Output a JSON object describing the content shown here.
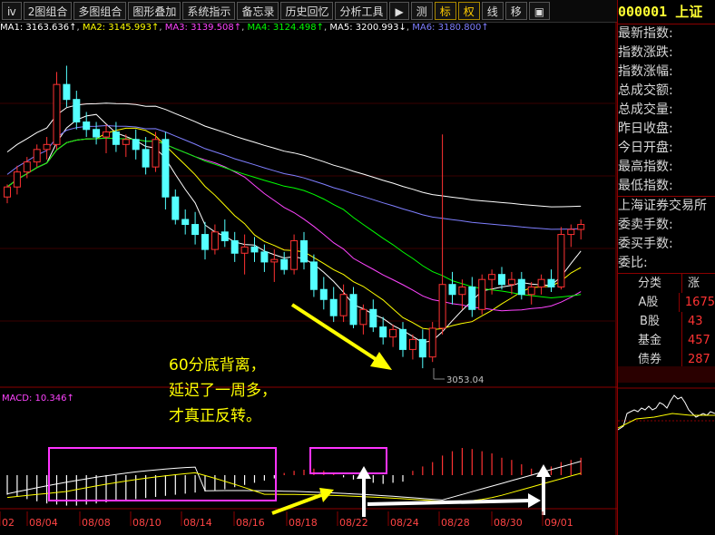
{
  "toolbar": {
    "buttons": [
      "2图组合",
      "多图组合",
      "图形叠加",
      "系统指示",
      "备忘录",
      "历史回忆",
      "分析工具"
    ],
    "right_buttons": [
      "测",
      "标",
      "权",
      "线",
      "移"
    ],
    "play_icon": "play-icon",
    "close_icon": "close-icon"
  },
  "ma_legend": {
    "ma1": "MA1: 3163.636↑",
    "ma2": "MA2: 3145.993↑",
    "ma3": "MA3: 3139.508↑",
    "ma4": "MA4: 3124.498↑",
    "ma5": "MA5: 3200.993↓",
    "ma6": "MA6: 3180.800↑",
    "colors": {
      "ma1": "#ffffff",
      "ma2": "#ffff00",
      "ma3": "#ff44ff",
      "ma4": "#00ff00",
      "ma5": "#7f7fff",
      "ma6": "#ffffff"
    }
  },
  "macd_label": "MACD: 10.346↑",
  "low_label": "3053.04",
  "annotation": [
    "60分底背离，",
    "延迟了一周多，",
    "才真正反转。"
  ],
  "x_ticks": [
    "02",
    "08/04",
    "08/08",
    "08/10",
    "08/14",
    "08/16",
    "08/18",
    "08/22",
    "08/24",
    "08/28",
    "08/30",
    "09/01"
  ],
  "right_panel": {
    "code": "000001",
    "name": "上证",
    "fields": [
      "最新指数:",
      "指数涨跌:",
      "指数涨幅:",
      "总成交额:",
      "总成交量:",
      "昨日收盘:",
      "今日开盘:",
      "最高指数:",
      "最低指数:"
    ],
    "exchange": "上海证券交易所",
    "order_fields": [
      "委卖手数:",
      "委买手数:",
      "委比:"
    ],
    "table_head": [
      "分类",
      "涨"
    ],
    "table_rows": [
      [
        "A股",
        "1675"
      ],
      [
        "B股",
        "43"
      ],
      [
        "基金",
        "457"
      ],
      [
        "债券",
        "287"
      ]
    ]
  },
  "colors": {
    "up": "#ff3232",
    "down": "#54ffff",
    "annotation_text": "#ffff00",
    "box": "#ff33ff",
    "arrow_yellow": "#ffff00",
    "arrow_white": "#ffffff",
    "divider": "#8b0000"
  },
  "chart_data": {
    "type": "candlestick",
    "price_range": [
      3040,
      3320
    ],
    "low_marker": 3053.04,
    "candles": [
      [
        3190,
        3200,
        3185,
        3198
      ],
      [
        3198,
        3215,
        3192,
        3210
      ],
      [
        3210,
        3222,
        3205,
        3218
      ],
      [
        3218,
        3232,
        3214,
        3228
      ],
      [
        3228,
        3238,
        3220,
        3232
      ],
      [
        3232,
        3290,
        3228,
        3280
      ],
      [
        3280,
        3295,
        3262,
        3268
      ],
      [
        3268,
        3275,
        3244,
        3250
      ],
      [
        3250,
        3258,
        3238,
        3244
      ],
      [
        3244,
        3250,
        3232,
        3238
      ],
      [
        3238,
        3248,
        3225,
        3242
      ],
      [
        3242,
        3250,
        3226,
        3232
      ],
      [
        3232,
        3240,
        3222,
        3236
      ],
      [
        3236,
        3244,
        3220,
        3228
      ],
      [
        3228,
        3238,
        3208,
        3214
      ],
      [
        3214,
        3242,
        3210,
        3236
      ],
      [
        3236,
        3242,
        3180,
        3190
      ],
      [
        3190,
        3196,
        3168,
        3172
      ],
      [
        3172,
        3180,
        3160,
        3168
      ],
      [
        3168,
        3178,
        3152,
        3160
      ],
      [
        3160,
        3170,
        3140,
        3148
      ],
      [
        3148,
        3168,
        3144,
        3162
      ],
      [
        3162,
        3172,
        3150,
        3155
      ],
      [
        3155,
        3162,
        3138,
        3145
      ],
      [
        3145,
        3160,
        3128,
        3150
      ],
      [
        3150,
        3158,
        3138,
        3146
      ],
      [
        3146,
        3152,
        3130,
        3138
      ],
      [
        3138,
        3148,
        3122,
        3140
      ],
      [
        3140,
        3146,
        3128,
        3132
      ],
      [
        3132,
        3160,
        3128,
        3155
      ],
      [
        3155,
        3162,
        3132,
        3138
      ],
      [
        3138,
        3144,
        3110,
        3116
      ],
      [
        3116,
        3126,
        3100,
        3108
      ],
      [
        3108,
        3118,
        3090,
        3095
      ],
      [
        3095,
        3120,
        3090,
        3112
      ],
      [
        3112,
        3118,
        3085,
        3088
      ],
      [
        3088,
        3104,
        3080,
        3100
      ],
      [
        3100,
        3108,
        3082,
        3086
      ],
      [
        3086,
        3094,
        3072,
        3078
      ],
      [
        3078,
        3088,
        3070,
        3084
      ],
      [
        3084,
        3090,
        3062,
        3068
      ],
      [
        3068,
        3080,
        3060,
        3076
      ],
      [
        3076,
        3084,
        3053,
        3062
      ],
      [
        3062,
        3090,
        3058,
        3085
      ],
      [
        3085,
        3240,
        3080,
        3120
      ],
      [
        3120,
        3130,
        3104,
        3112
      ],
      [
        3112,
        3124,
        3100,
        3118
      ],
      [
        3118,
        3126,
        3094,
        3100
      ],
      [
        3100,
        3128,
        3096,
        3124
      ],
      [
        3124,
        3132,
        3112,
        3128
      ],
      [
        3128,
        3134,
        3116,
        3120
      ],
      [
        3120,
        3130,
        3112,
        3124
      ],
      [
        3124,
        3130,
        3108,
        3112
      ],
      [
        3112,
        3122,
        3104,
        3118
      ],
      [
        3118,
        3128,
        3112,
        3124
      ],
      [
        3124,
        3132,
        3114,
        3118
      ],
      [
        3118,
        3166,
        3116,
        3160
      ],
      [
        3160,
        3168,
        3150,
        3164
      ],
      [
        3164,
        3172,
        3156,
        3168
      ]
    ],
    "macd": [
      -18,
      -20,
      -22,
      -24,
      -26,
      -27,
      -28,
      -28,
      -27,
      -26,
      -25,
      -24,
      -23,
      -22,
      -21,
      -20,
      -19,
      -18,
      -17,
      -16,
      -15,
      -14,
      -13,
      -11,
      -9,
      -7,
      -5,
      -3,
      2,
      4,
      5,
      6,
      4,
      2,
      -2,
      -4,
      -6,
      -7,
      -8,
      -7,
      -6,
      4,
      8,
      12,
      18,
      22,
      25,
      24,
      22,
      20,
      16,
      14,
      10,
      6,
      5,
      8,
      12,
      14,
      16
    ],
    "macd_range": [
      -30,
      30
    ]
  }
}
